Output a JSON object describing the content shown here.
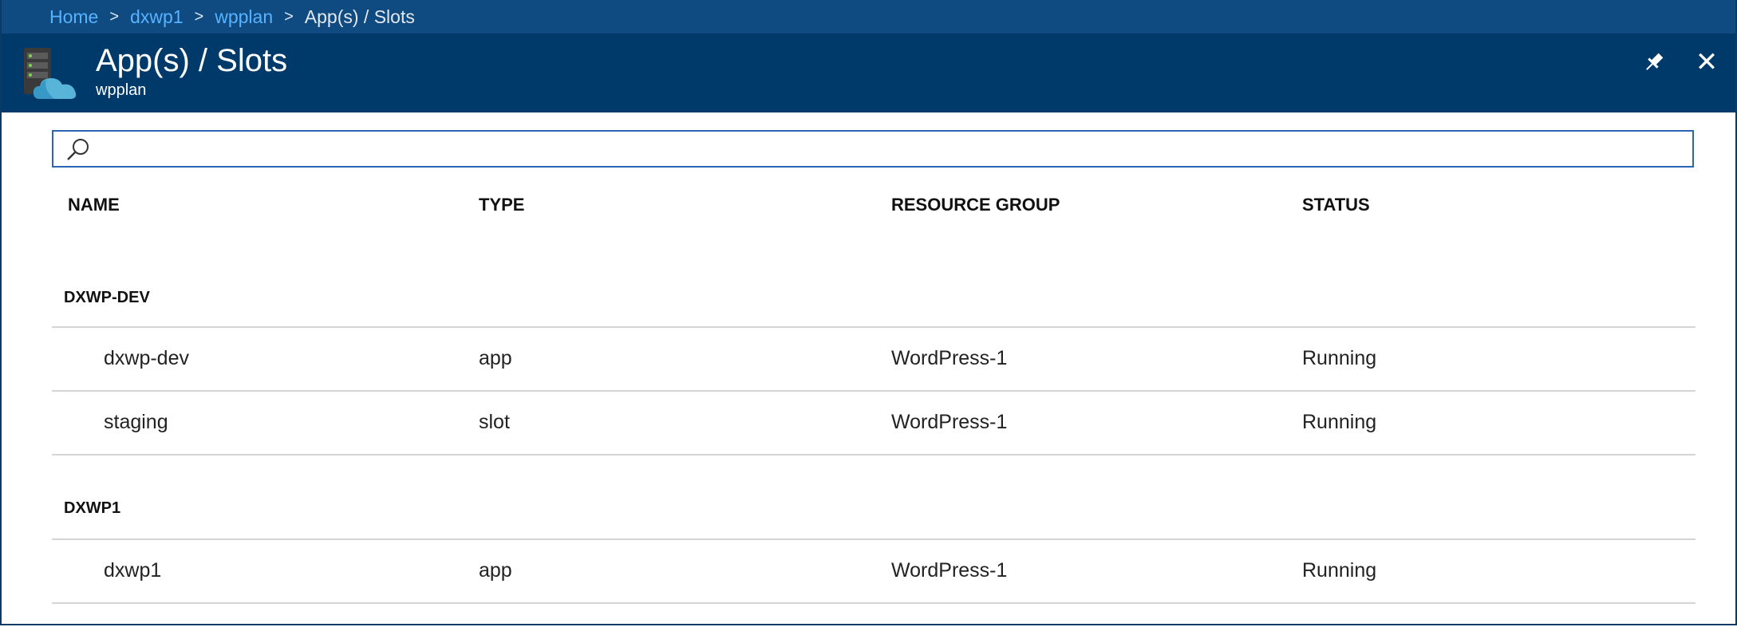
{
  "breadcrumb": {
    "items": [
      {
        "label": "Home"
      },
      {
        "label": "dxwp1"
      },
      {
        "label": "wpplan"
      }
    ],
    "current": "App(s) / Slots",
    "separator": ">"
  },
  "header": {
    "title": "App(s) / Slots",
    "subtitle": "wpplan",
    "icon": "app-service-plan-icon",
    "pin_icon": "pin-icon",
    "close_icon": "close-icon",
    "close_glyph": "✕"
  },
  "search": {
    "placeholder": "",
    "value": "",
    "icon": "search-icon"
  },
  "table": {
    "columns": [
      "NAME",
      "TYPE",
      "RESOURCE GROUP",
      "STATUS"
    ],
    "groups": [
      {
        "label": "DXWP-DEV",
        "rows": [
          {
            "name": "dxwp-dev",
            "type": "app",
            "resource_group": "WordPress-1",
            "status": "Running"
          },
          {
            "name": "staging",
            "type": "slot",
            "resource_group": "WordPress-1",
            "status": "Running"
          }
        ]
      },
      {
        "label": "DXWP1",
        "rows": [
          {
            "name": "dxwp1",
            "type": "app",
            "resource_group": "WordPress-1",
            "status": "Running"
          }
        ]
      }
    ]
  },
  "colors": {
    "breadcrumb_bg": "#0f4a80",
    "header_bg": "#003a6b",
    "link": "#57b3ff",
    "search_border": "#2a66b4",
    "row_divider": "#d5d5d5"
  }
}
